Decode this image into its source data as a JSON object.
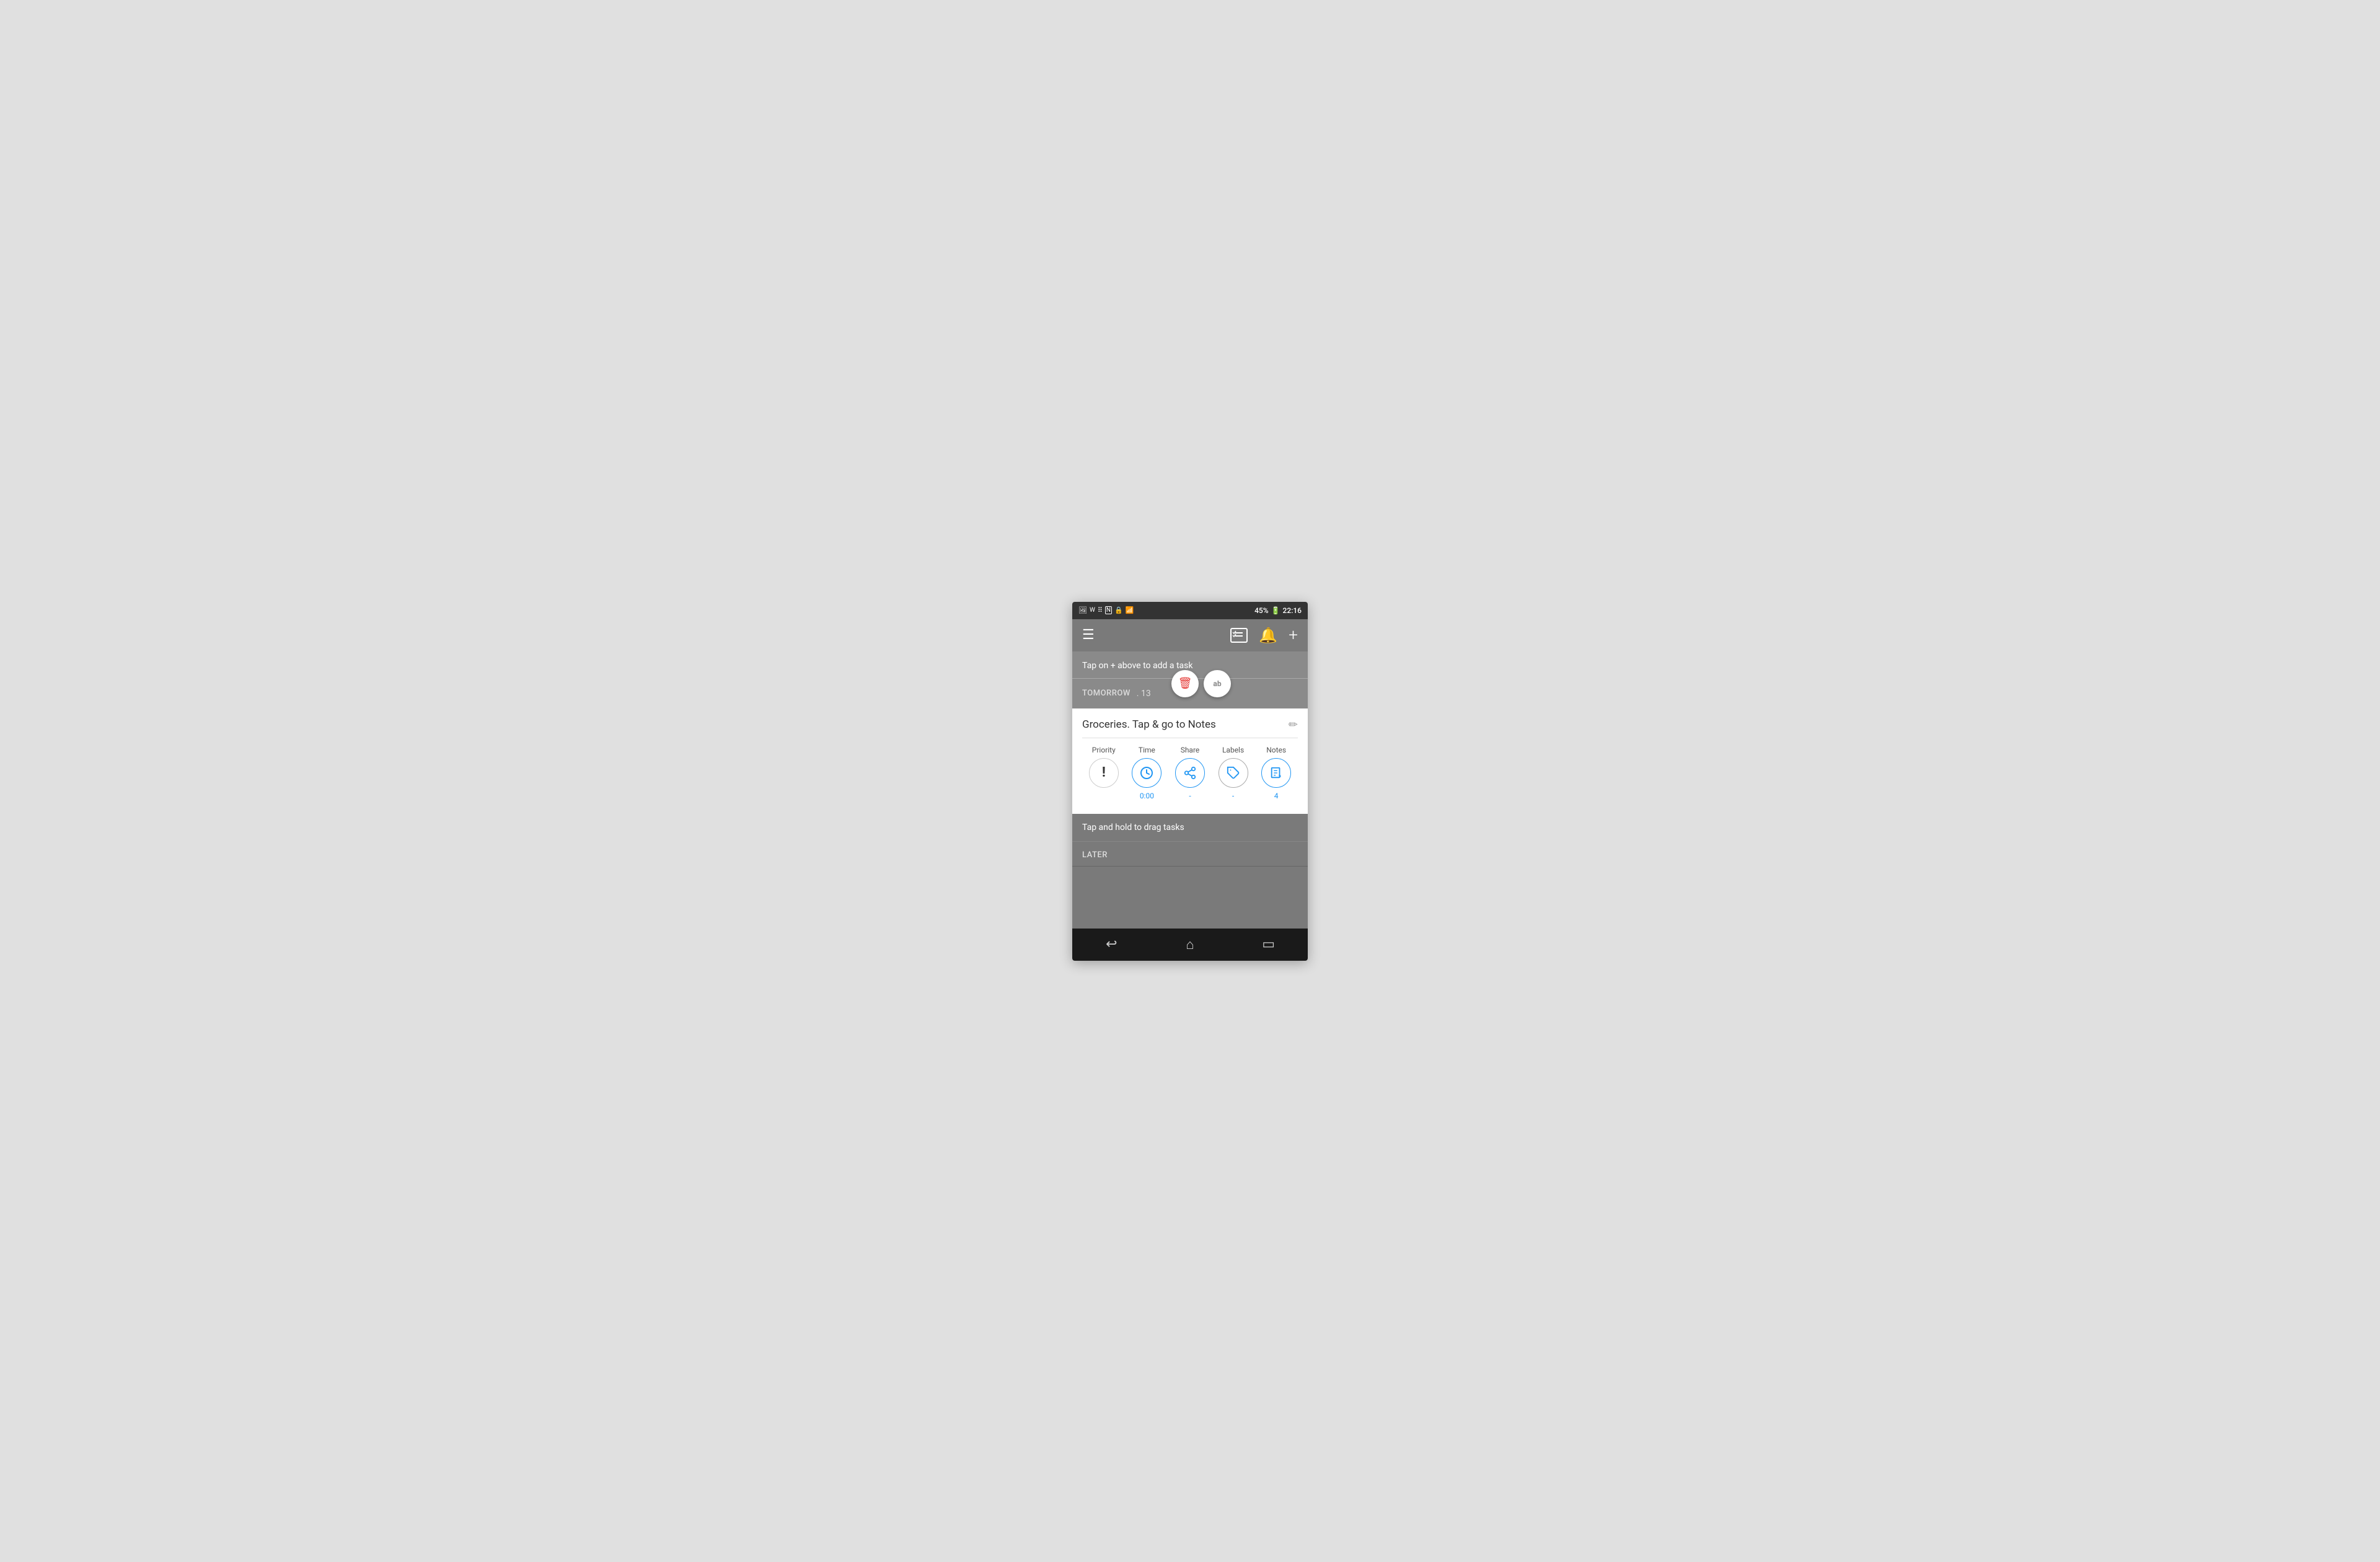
{
  "statusBar": {
    "time": "22:16",
    "battery": "45%",
    "icons": [
      "image",
      "whatsapp",
      "grid",
      "nfc",
      "vpn",
      "wifi",
      "signal"
    ]
  },
  "header": {
    "menuLabel": "☰",
    "bellLabel": "🔔",
    "plusLabel": "+",
    "checklistTitle": "checklist"
  },
  "taskHint": {
    "text": "Tap on + above to add a task"
  },
  "tomorrowSection": {
    "label": "TOMORROW",
    "number": "13"
  },
  "fabButtons": {
    "deleteLabel": "🗑",
    "renameLabel": "ab"
  },
  "taskDetail": {
    "title": "Groceries. Tap & go to Notes",
    "editIconLabel": "✏"
  },
  "actionButtons": [
    {
      "id": "priority",
      "label": "Priority",
      "icon": "!",
      "value": ""
    },
    {
      "id": "time",
      "label": "Time",
      "icon": "clock",
      "value": "0:00"
    },
    {
      "id": "share",
      "label": "Share",
      "icon": "share",
      "value": "-"
    },
    {
      "id": "labels",
      "label": "Labels",
      "icon": "tag",
      "value": "-"
    },
    {
      "id": "notes",
      "label": "Notes",
      "icon": "notes",
      "value": "4"
    }
  ],
  "bottomSection": {
    "dragHint": "Tap and hold to drag tasks",
    "laterLabel": "LATER"
  },
  "navBar": {
    "backLabel": "↩",
    "homeLabel": "⌂",
    "recentLabel": "▭"
  }
}
